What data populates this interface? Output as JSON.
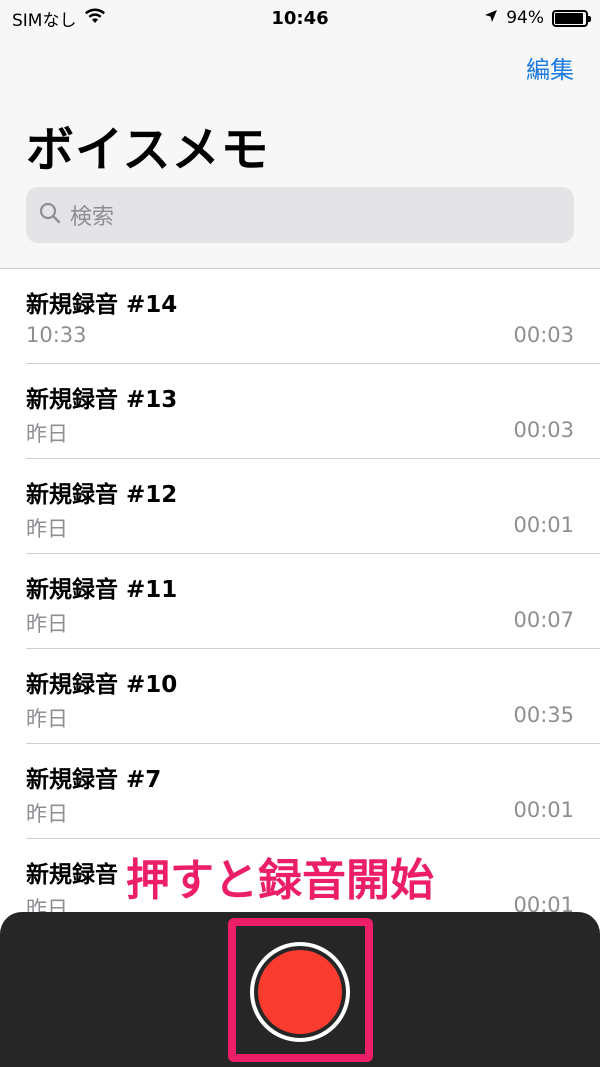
{
  "status_bar": {
    "carrier": "SIMなし",
    "time": "10:46",
    "battery": "94%",
    "battery_level": 0.94
  },
  "header": {
    "edit_label": "編集",
    "title": "ボイスメモ"
  },
  "search": {
    "placeholder": "検索"
  },
  "recordings": [
    {
      "title": "新規録音 #14",
      "date": "10:33",
      "duration": "00:03"
    },
    {
      "title": "新規録音 #13",
      "date": "昨日",
      "duration": "00:03"
    },
    {
      "title": "新規録音 #12",
      "date": "昨日",
      "duration": "00:01"
    },
    {
      "title": "新規録音 #11",
      "date": "昨日",
      "duration": "00:07"
    },
    {
      "title": "新規録音 #10",
      "date": "昨日",
      "duration": "00:35"
    },
    {
      "title": "新規録音 #7",
      "date": "昨日",
      "duration": "00:01"
    },
    {
      "title": "新規録音",
      "date": "昨日",
      "duration": "00:01"
    }
  ],
  "annotation": {
    "text": "押すと録音開始",
    "color": "#ec1e68"
  },
  "colors": {
    "accent": "#1a7ae0",
    "record": "#fa3b30",
    "panel": "#262626"
  },
  "icons": {
    "wifi": "wifi-icon",
    "location": "location-arrow-icon",
    "battery": "battery-icon",
    "search": "search-icon",
    "record": "record-icon"
  }
}
